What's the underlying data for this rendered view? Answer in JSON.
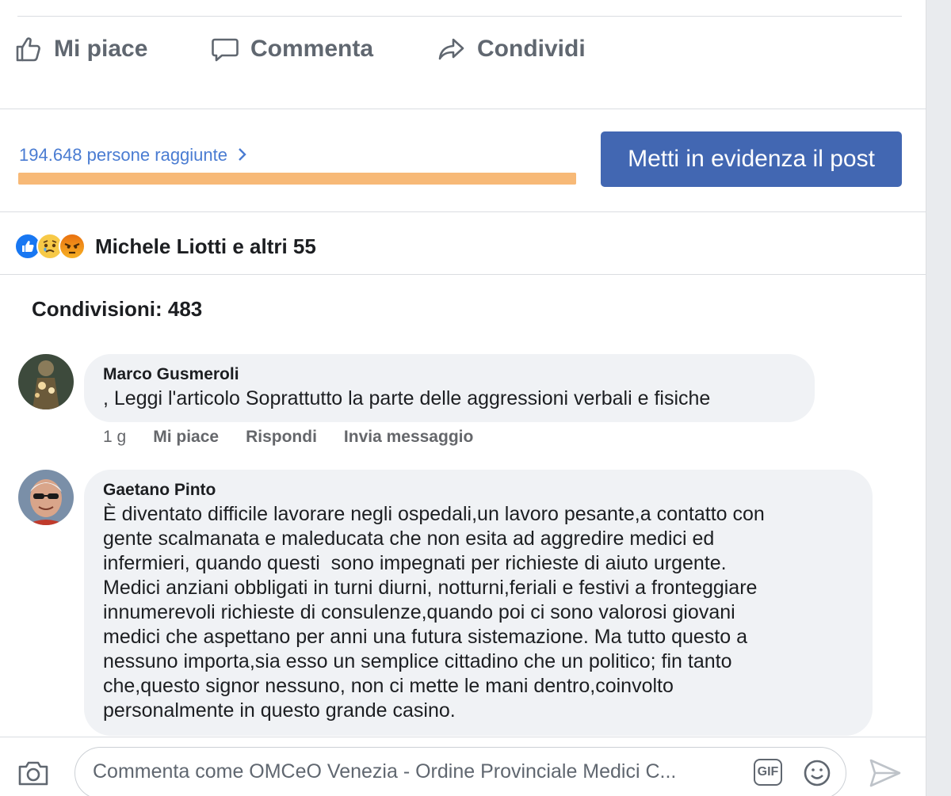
{
  "actions": {
    "like_label": "Mi piace",
    "comment_label": "Commenta",
    "share_label": "Condividi"
  },
  "reach": {
    "link_text": "194.648 persone raggiunte",
    "progress_fraction": 1.0,
    "boost_label": "Metti in evidenza il post"
  },
  "reactions": {
    "icons": [
      "like-reaction-icon",
      "sad-reaction-icon",
      "angry-reaction-icon"
    ],
    "summary": "Michele Liotti e altri 55"
  },
  "shares": {
    "label": "Condivisioni: 483"
  },
  "comments": [
    {
      "author": "Marco Gusmeroli",
      "text": ", Leggi l'articolo Soprattutto la parte delle aggressioni verbali e fisiche",
      "meta": {
        "time": "1 g",
        "like": "Mi piace",
        "reply": "Rispondi",
        "message": "Invia messaggio"
      }
    },
    {
      "author": "Gaetano Pinto",
      "lines": [
        "È diventato difficile lavorare negli ospedali,un lavoro pesante,a contatto con",
        "gente scalmanata e maleducata che non esita ad aggredire medici ed",
        "infermieri, quando questi  sono impegnati per richieste di aiuto urgente.",
        "Medici anziani obbligati in turni diurni, notturni,feriali e festivi a fronteggiare",
        "innumerevoli richieste di consulenze,quando poi ci sono valorosi giovani",
        "medici che aspettano per anni una futura sistemazione. Ma tutto questo a",
        "nessuno importa,sia esso un semplice cittadino che un politico; fin tanto",
        "che,questo signor nessuno, non ci mette le mani dentro,coinvolto",
        "personalmente in questo grande casino."
      ]
    }
  ],
  "composer": {
    "placeholder": "Commenta come OMCeO Venezia - Ordine Provinciale Medici C...",
    "gif_label": "GIF"
  },
  "colors": {
    "accent": "#4267b2",
    "link": "#4a7cd2",
    "reach_bar": "#ffc58a",
    "bubble": "#f0f2f5"
  }
}
